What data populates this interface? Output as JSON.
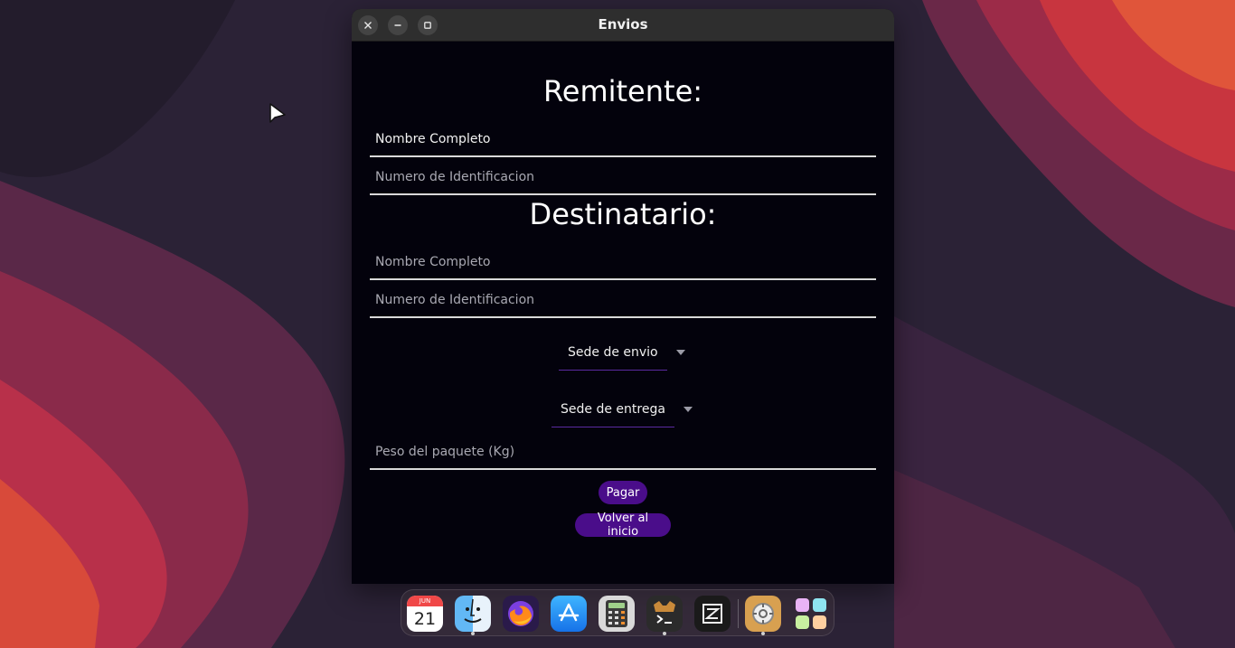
{
  "window": {
    "title": "Envios"
  },
  "form": {
    "sender_title": "Remitente:",
    "sender_name_placeholder": "Nombre Completo",
    "sender_id_placeholder": "Numero de Identificacion",
    "recipient_title": "Destinatario:",
    "recipient_name_placeholder": "Nombre Completo",
    "recipient_id_placeholder": "Numero de Identificacion",
    "origin_dropdown": "Sede de envio",
    "destination_dropdown": "Sede de entrega",
    "weight_placeholder": "Peso del paquete (Kg)",
    "pay_button": "Pagar",
    "back_button": "Volver al inicio"
  },
  "dock": {
    "calendar": {
      "month": "JUN",
      "day": "21"
    },
    "apps": [
      "calendar-icon",
      "finder-icon",
      "firefox-icon",
      "app-store-icon",
      "calculator-icon",
      "terminal-icon",
      "text-editor-icon",
      "system-settings-icon",
      "launchpad-icon"
    ]
  },
  "colors": {
    "window_bg": "#03020c",
    "accent": "#4a0d8a",
    "titlebar": "#2e2e2e"
  }
}
